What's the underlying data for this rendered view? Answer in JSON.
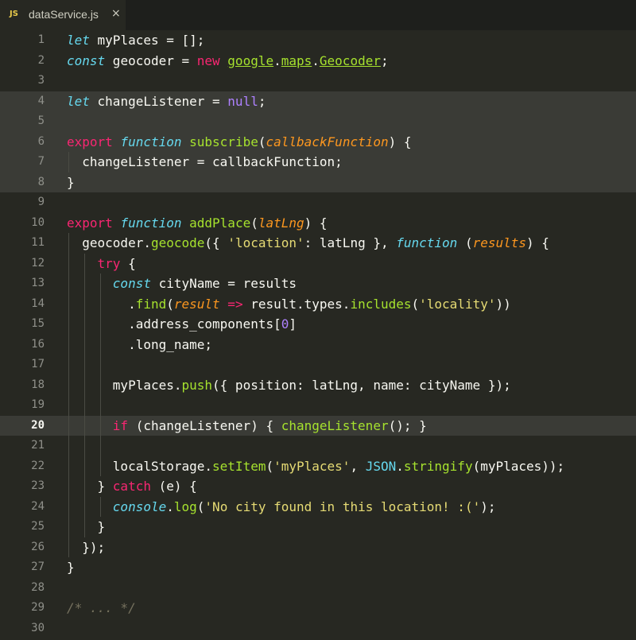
{
  "tab": {
    "language_badge": "JS",
    "filename": "dataService.js",
    "close_glyph": "×"
  },
  "colors": {
    "background": "#272822",
    "keyword": "#f92672",
    "storage": "#66d9ef",
    "function": "#a6e22e",
    "parameter": "#fd971f",
    "string": "#e6db74",
    "number": "#ae81ff",
    "comment": "#75715e",
    "text": "#f8f8f2"
  },
  "editor": {
    "highlighted_lines": [
      4,
      5,
      6,
      7,
      8,
      20
    ],
    "current_line": 20,
    "lines": [
      {
        "n": "1",
        "indent": 0,
        "tokens": [
          [
            "st",
            "let"
          ],
          [
            "id",
            " myPlaces = [];"
          ]
        ]
      },
      {
        "n": "2",
        "indent": 0,
        "tokens": [
          [
            "st",
            "const"
          ],
          [
            "id",
            " geocoder = "
          ],
          [
            "kw",
            "new "
          ],
          [
            "ul",
            "google"
          ],
          [
            "id",
            "."
          ],
          [
            "ul",
            "maps"
          ],
          [
            "id",
            "."
          ],
          [
            "ul",
            "Geocoder"
          ],
          [
            "id",
            ";"
          ]
        ]
      },
      {
        "n": "3",
        "indent": 0,
        "tokens": []
      },
      {
        "n": "4",
        "indent": 0,
        "tokens": [
          [
            "st",
            "let"
          ],
          [
            "id",
            " changeListener = "
          ],
          [
            "num",
            "null"
          ],
          [
            "id",
            ";"
          ]
        ]
      },
      {
        "n": "5",
        "indent": 0,
        "tokens": []
      },
      {
        "n": "6",
        "indent": 0,
        "tokens": [
          [
            "kw",
            "export "
          ],
          [
            "st",
            "function "
          ],
          [
            "fn",
            "subscribe"
          ],
          [
            "id",
            "("
          ],
          [
            "pa",
            "callbackFunction"
          ],
          [
            "id",
            ") {"
          ]
        ]
      },
      {
        "n": "7",
        "indent": 1,
        "tokens": [
          [
            "id",
            "  changeListener = callbackFunction;"
          ]
        ]
      },
      {
        "n": "8",
        "indent": 0,
        "tokens": [
          [
            "id",
            "}"
          ]
        ]
      },
      {
        "n": "9",
        "indent": 0,
        "tokens": []
      },
      {
        "n": "10",
        "indent": 0,
        "tokens": [
          [
            "kw",
            "export "
          ],
          [
            "st",
            "function "
          ],
          [
            "fn",
            "addPlace"
          ],
          [
            "id",
            "("
          ],
          [
            "pa",
            "latLng"
          ],
          [
            "id",
            ") {"
          ]
        ]
      },
      {
        "n": "11",
        "indent": 1,
        "tokens": [
          [
            "id",
            "  geocoder."
          ],
          [
            "fn",
            "geocode"
          ],
          [
            "id",
            "({ "
          ],
          [
            "str",
            "'location'"
          ],
          [
            "id",
            ": latLng }, "
          ],
          [
            "st",
            "function "
          ],
          [
            "id",
            "("
          ],
          [
            "pa",
            "results"
          ],
          [
            "id",
            ") {"
          ]
        ]
      },
      {
        "n": "12",
        "indent": 2,
        "tokens": [
          [
            "id",
            "    "
          ],
          [
            "kw",
            "try"
          ],
          [
            "id",
            " {"
          ]
        ]
      },
      {
        "n": "13",
        "indent": 3,
        "tokens": [
          [
            "id",
            "      "
          ],
          [
            "st",
            "const"
          ],
          [
            "id",
            " cityName = results"
          ]
        ]
      },
      {
        "n": "14",
        "indent": 3,
        "tokens": [
          [
            "id",
            "        ."
          ],
          [
            "fn",
            "find"
          ],
          [
            "id",
            "("
          ],
          [
            "pa",
            "result"
          ],
          [
            "kw",
            " => "
          ],
          [
            "id",
            "result.types."
          ],
          [
            "fn",
            "includes"
          ],
          [
            "id",
            "("
          ],
          [
            "str",
            "'locality'"
          ],
          [
            "id",
            "))"
          ]
        ]
      },
      {
        "n": "15",
        "indent": 3,
        "tokens": [
          [
            "id",
            "        .address_components["
          ],
          [
            "num",
            "0"
          ],
          [
            "id",
            "]"
          ]
        ]
      },
      {
        "n": "16",
        "indent": 3,
        "tokens": [
          [
            "id",
            "        .long_name;"
          ]
        ]
      },
      {
        "n": "17",
        "indent": 3,
        "tokens": []
      },
      {
        "n": "18",
        "indent": 3,
        "tokens": [
          [
            "id",
            "      myPlaces."
          ],
          [
            "fn",
            "push"
          ],
          [
            "id",
            "({ position: latLng, name: cityName });"
          ]
        ]
      },
      {
        "n": "19",
        "indent": 3,
        "tokens": []
      },
      {
        "n": "20",
        "indent": 3,
        "tokens": [
          [
            "id",
            "      "
          ],
          [
            "kw",
            "if"
          ],
          [
            "id",
            " (changeListener) { "
          ],
          [
            "fn",
            "changeListener"
          ],
          [
            "id",
            "(); }"
          ]
        ]
      },
      {
        "n": "21",
        "indent": 3,
        "tokens": []
      },
      {
        "n": "22",
        "indent": 3,
        "tokens": [
          [
            "id",
            "      localStorage."
          ],
          [
            "fn",
            "setItem"
          ],
          [
            "id",
            "("
          ],
          [
            "str",
            "'myPlaces'"
          ],
          [
            "id",
            ", "
          ],
          [
            "cl",
            "JSON"
          ],
          [
            "id",
            "."
          ],
          [
            "fn",
            "stringify"
          ],
          [
            "id",
            "(myPlaces));"
          ]
        ]
      },
      {
        "n": "23",
        "indent": 2,
        "tokens": [
          [
            "id",
            "    } "
          ],
          [
            "kw",
            "catch"
          ],
          [
            "id",
            " (e) {"
          ]
        ]
      },
      {
        "n": "24",
        "indent": 3,
        "tokens": [
          [
            "id",
            "      "
          ],
          [
            "st",
            "console"
          ],
          [
            "id",
            "."
          ],
          [
            "fn",
            "log"
          ],
          [
            "id",
            "("
          ],
          [
            "str",
            "'No city found in this location! :('"
          ],
          [
            "id",
            ");"
          ]
        ]
      },
      {
        "n": "25",
        "indent": 2,
        "tokens": [
          [
            "id",
            "    }"
          ]
        ]
      },
      {
        "n": "26",
        "indent": 1,
        "tokens": [
          [
            "id",
            "  });"
          ]
        ]
      },
      {
        "n": "27",
        "indent": 0,
        "tokens": [
          [
            "id",
            "}"
          ]
        ]
      },
      {
        "n": "28",
        "indent": 0,
        "tokens": []
      },
      {
        "n": "29",
        "indent": 0,
        "tokens": [
          [
            "cm",
            "/* ... */"
          ]
        ]
      },
      {
        "n": "30",
        "indent": 0,
        "tokens": []
      }
    ]
  }
}
